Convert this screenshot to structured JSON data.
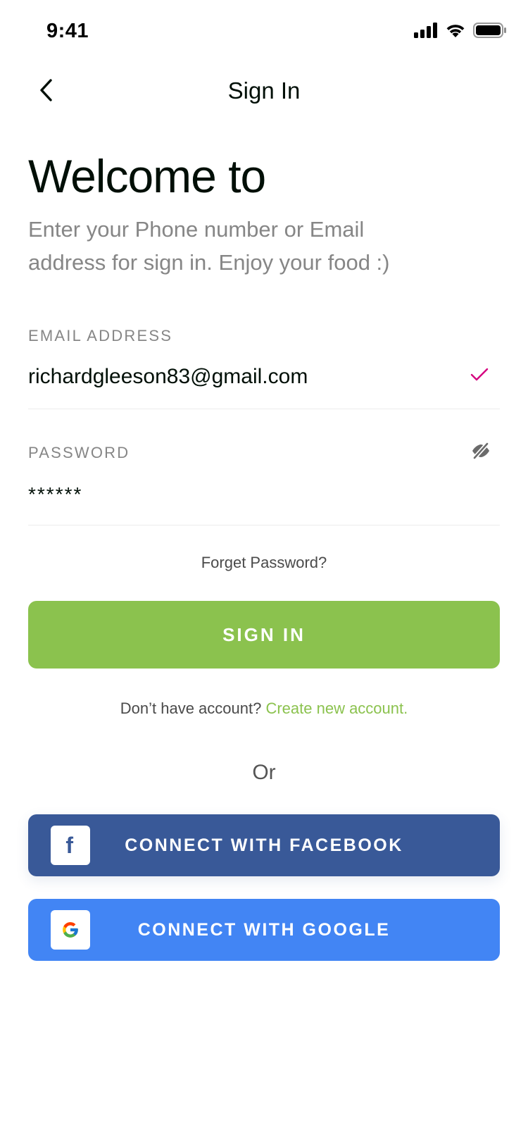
{
  "status_bar": {
    "time": "9:41",
    "icons": [
      "signal-icon",
      "wifi-icon",
      "battery-icon"
    ]
  },
  "nav": {
    "back_icon": "chevron-left-icon",
    "title": "Sign In"
  },
  "welcome": {
    "title": "Welcome to",
    "subtitle": "Enter your Phone number or Email address for sign in. Enjoy your food :)"
  },
  "form": {
    "email_label": "EMAIL ADDRESS",
    "email_value": "richardgleeson83@gmail.com",
    "email_valid_icon": "check-icon",
    "password_label": "PASSWORD",
    "password_value": "******",
    "password_toggle_icon": "eye-off-icon",
    "forgot_label": "Forget Password?",
    "signin_label": "SIGN IN"
  },
  "signup": {
    "prompt": "Don’t have account?",
    "link": "Create new account."
  },
  "social": {
    "or_label": "Or",
    "facebook_label": "CONNECT WITH FACEBOOK",
    "facebook_icon": "facebook-icon",
    "facebook_icon_letter": "f",
    "google_label": "CONNECT WITH GOOGLE",
    "google_icon": "google-icon"
  },
  "colors": {
    "primary_green": "#8BC24E",
    "facebook_blue": "#395998",
    "google_blue": "#4285F4",
    "check_magenta": "#D5007F",
    "text_dark": "#010F07",
    "text_muted": "#868686"
  }
}
